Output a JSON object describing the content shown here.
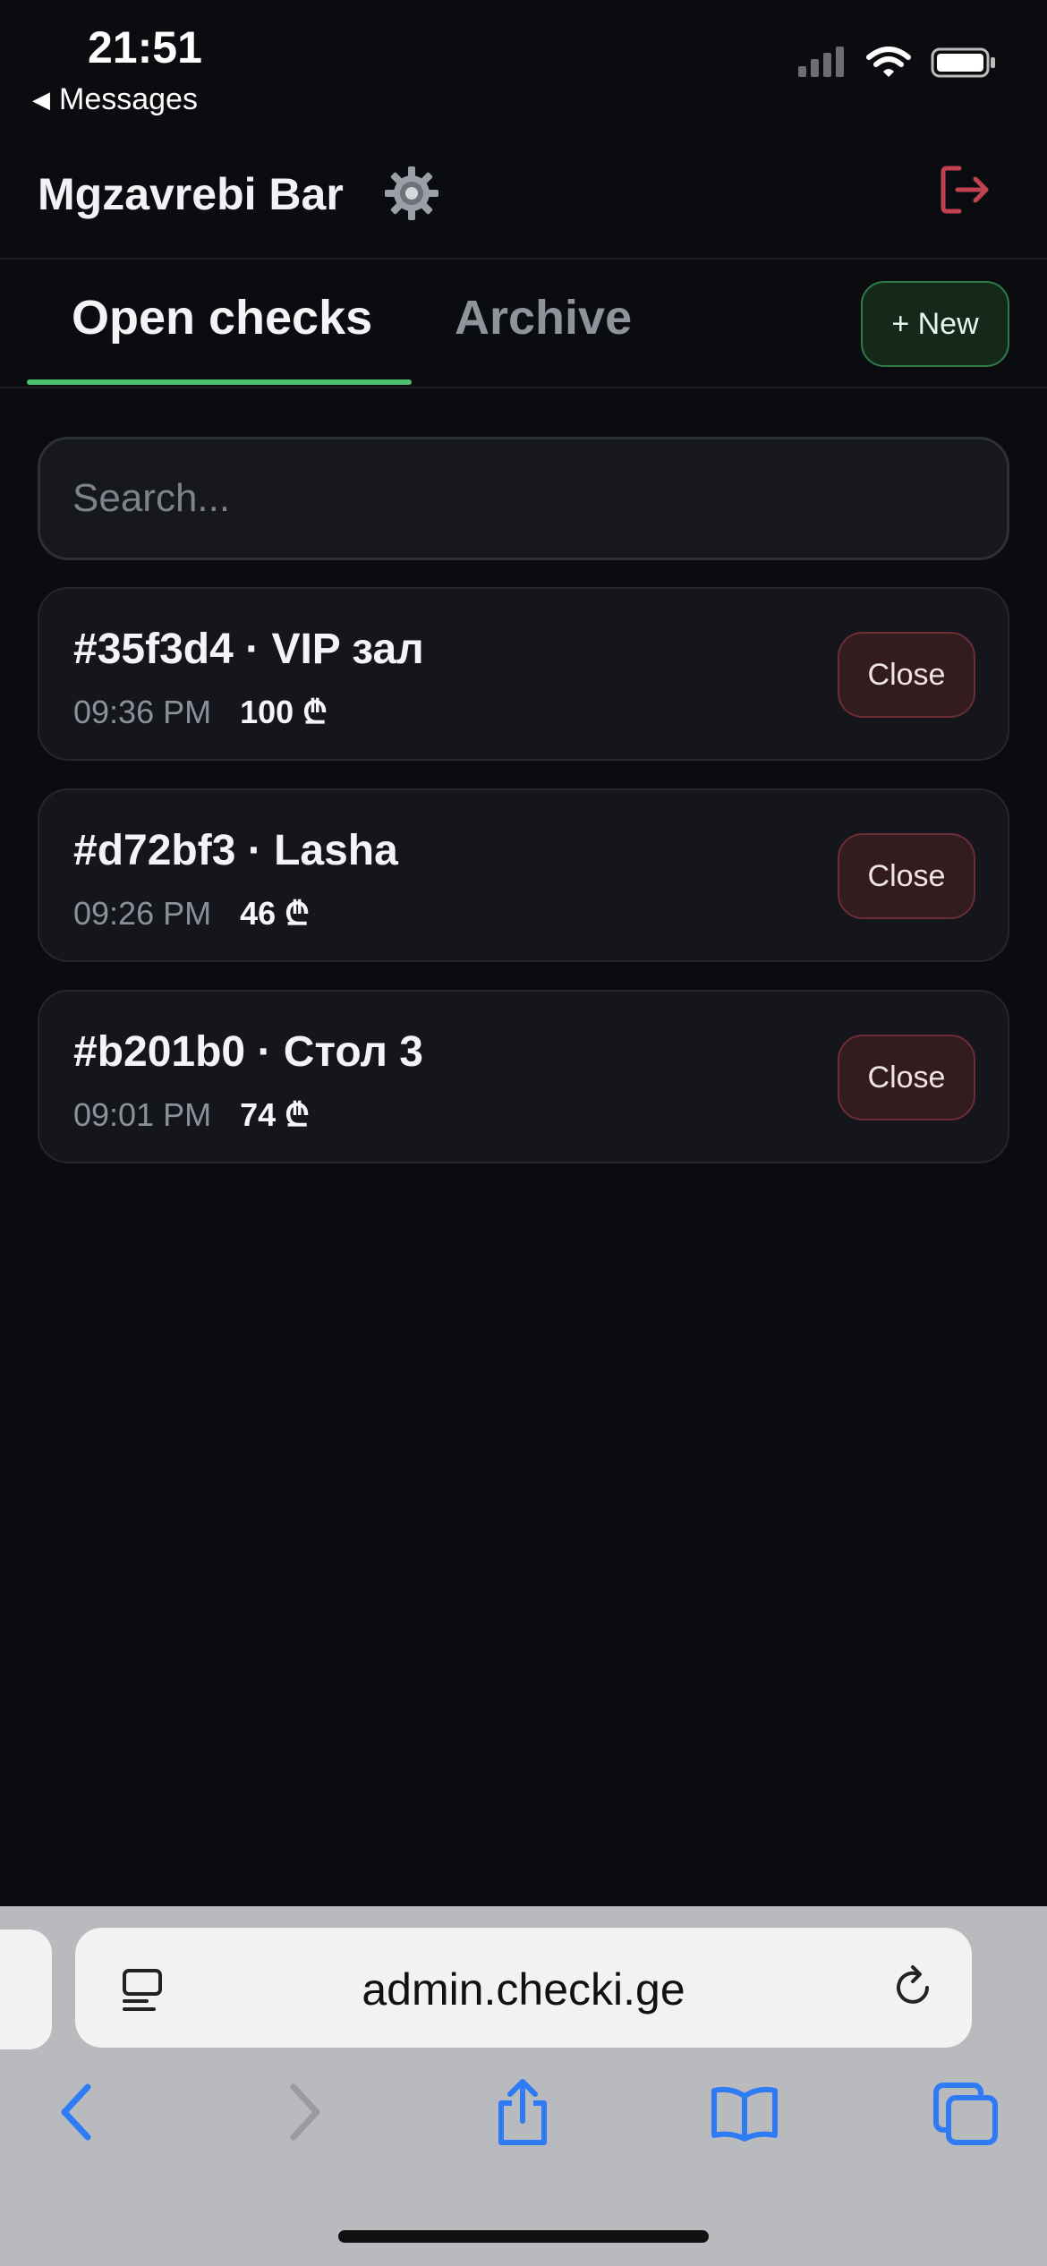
{
  "status_bar": {
    "time": "21:51",
    "back_label": "Messages",
    "icons": [
      "cellular-signal-icon",
      "wifi-icon",
      "battery-icon"
    ]
  },
  "header": {
    "title": "Mgzavrebi Bar",
    "settings_icon": "gear-icon",
    "logout_icon": "logout-icon",
    "logout_color": "#c1434f"
  },
  "tabs": {
    "open_label": "Open checks",
    "archive_label": "Archive",
    "active": "open",
    "accent_color": "#4cc06e",
    "new_label": "+ New"
  },
  "search": {
    "placeholder": "Search...",
    "value": ""
  },
  "checks": [
    {
      "title": "#35f3d4 · VIP зал",
      "time": "09:36 PM",
      "amount": "100 ₾",
      "action": "Close"
    },
    {
      "title": "#d72bf3 · Lasha",
      "time": "09:26 PM",
      "amount": "46 ₾",
      "action": "Close"
    },
    {
      "title": "#b201b0 · Стол 3",
      "time": "09:01 PM",
      "amount": "74 ₾",
      "action": "Close"
    }
  ],
  "browser": {
    "url": "admin.checki.ge",
    "accent_color": "#2f7bf6",
    "toolbar": [
      "back-icon",
      "forward-icon",
      "share-icon",
      "bookmarks-icon",
      "tabs-icon"
    ]
  }
}
